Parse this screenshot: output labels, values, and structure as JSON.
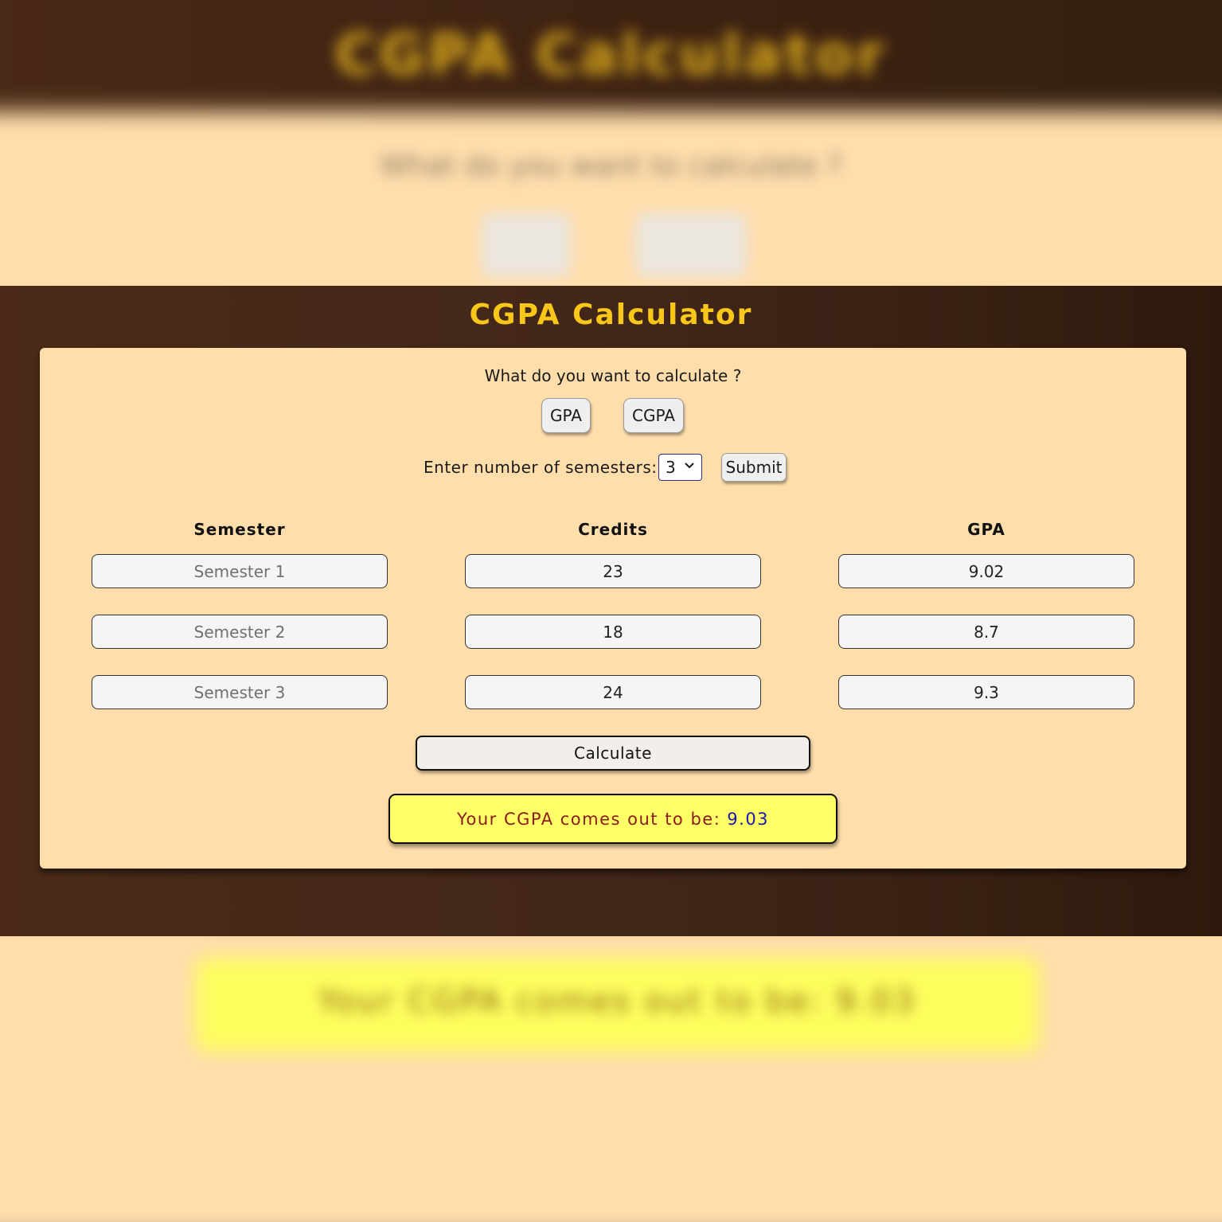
{
  "background": {
    "title": "CGPA Calculator",
    "question": "What do you want to calculate ?",
    "result_text": "Your CGPA comes out to be:",
    "result_value": "9.03"
  },
  "modal": {
    "title": "CGPA Calculator",
    "question": "What do you want to calculate ?",
    "mode_buttons": {
      "gpa": "GPA",
      "cgpa": "CGPA"
    },
    "semester_count_label": "Enter number of semesters:",
    "semester_count_value": "3",
    "submit_label": "Submit",
    "columns": {
      "semester": "Semester",
      "credits": "Credits",
      "gpa": "GPA"
    },
    "rows": [
      {
        "semester_placeholder": "Semester 1",
        "credits": "23",
        "gpa": "9.02"
      },
      {
        "semester_placeholder": "Semester 2",
        "credits": "18",
        "gpa": "8.7"
      },
      {
        "semester_placeholder": "Semester 3",
        "credits": "24",
        "gpa": "9.3"
      }
    ],
    "calculate_label": "Calculate",
    "result_text": "Your CGPA comes out to be:",
    "result_value": "9.03"
  },
  "colors": {
    "dark_brown": "#3d2314",
    "cream": "#ffdeac",
    "title_gold": "#f9c61a",
    "result_yellow": "#ffff66",
    "result_text": "#8b1a1a",
    "result_value": "#1a17b5"
  },
  "icons": {
    "select_arrow": "chevron-down-icon"
  }
}
